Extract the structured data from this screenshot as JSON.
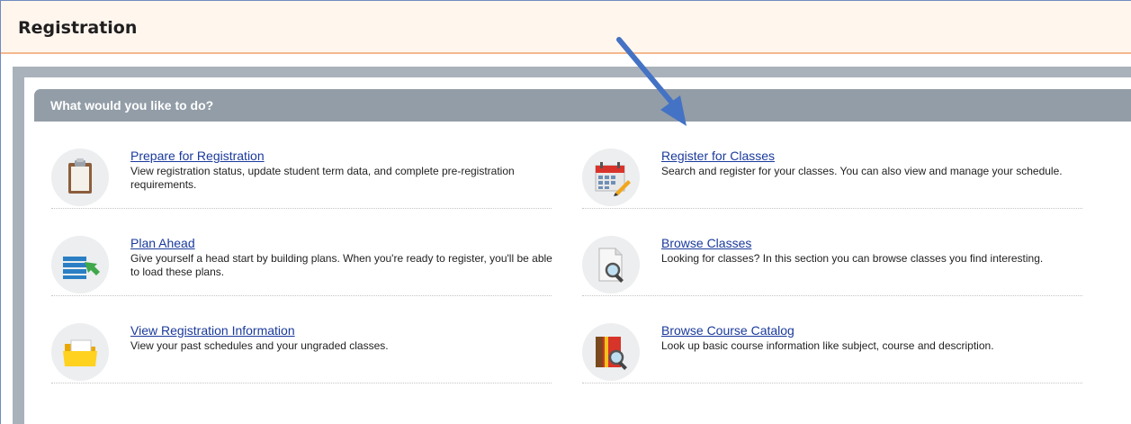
{
  "header": {
    "title": "Registration"
  },
  "panel": {
    "title": "What would you like to do?"
  },
  "items": [
    {
      "label": "Prepare for Registration",
      "description": "View registration status, update student term data, and complete pre-registration requirements.",
      "icon": "clipboard-icon"
    },
    {
      "label": "Register for Classes",
      "description": "Search and register for your classes. You can also view and manage your schedule.",
      "icon": "calendar-icon"
    },
    {
      "label": "Plan Ahead",
      "description": "Give yourself a head start by building plans. When you're ready to register, you'll be able to load these plans.",
      "icon": "list-arrow-icon"
    },
    {
      "label": "Browse Classes",
      "description": "Looking for classes? In this section you can browse classes you find interesting.",
      "icon": "document-search-icon"
    },
    {
      "label": "View Registration Information",
      "description": "View your past schedules and your ungraded classes.",
      "icon": "folder-icon"
    },
    {
      "label": "Browse Course Catalog",
      "description": "Look up basic course information like subject, course and description.",
      "icon": "book-search-icon"
    }
  ],
  "colors": {
    "link": "#1a3a9c",
    "header_bg": "#fff6ee",
    "panel_header_bg": "#929da7",
    "arrow": "#4472c4"
  }
}
